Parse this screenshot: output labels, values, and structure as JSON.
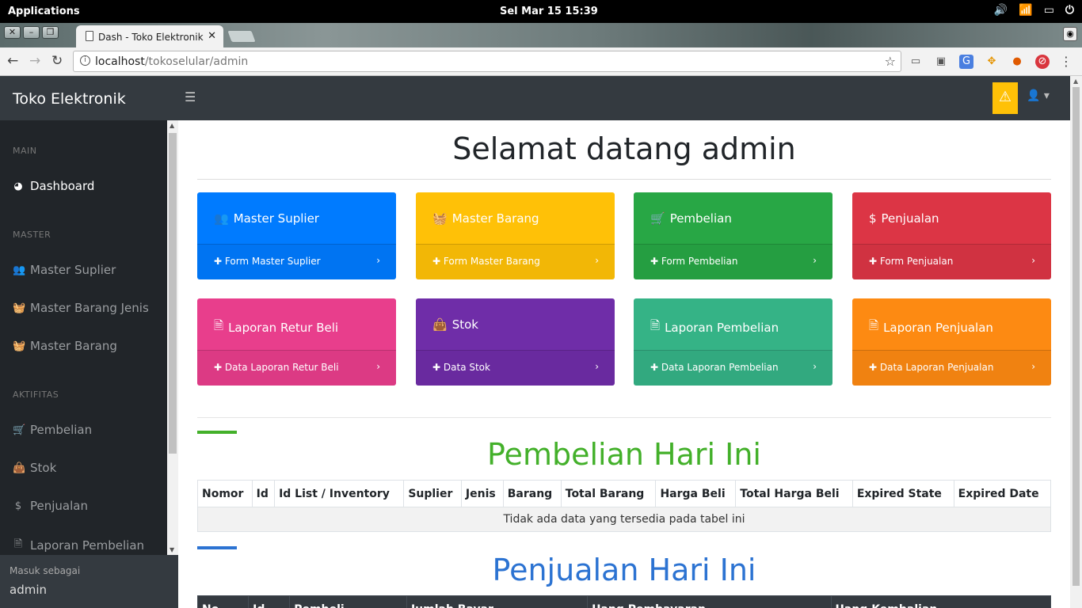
{
  "system": {
    "apps_label": "Applications",
    "clock": "Sel Mar 15    15:39"
  },
  "browser": {
    "tab_title": "Dash - Toko Elektronik",
    "url_host": "localhost",
    "url_path": "/tokoselular/admin"
  },
  "header": {
    "brand": "Toko Elektronik"
  },
  "sidebar": {
    "sections": [
      {
        "heading": "MAIN",
        "items": [
          {
            "label": "Dashboard",
            "icon": "dashboard-icon",
            "glyph": "◕"
          }
        ]
      },
      {
        "heading": "MASTER",
        "items": [
          {
            "label": "Master Suplier",
            "icon": "users-icon",
            "glyph": "👥"
          },
          {
            "label": "Master Barang Jenis",
            "icon": "basket-icon",
            "glyph": "🧺"
          },
          {
            "label": "Master Barang",
            "icon": "basket-icon",
            "glyph": "🧺"
          }
        ]
      },
      {
        "heading": "AKTIFITAS",
        "items": [
          {
            "label": "Pembelian",
            "icon": "cart-icon",
            "glyph": "🛒"
          },
          {
            "label": "Stok",
            "icon": "shopping-bag-icon",
            "glyph": "👜"
          },
          {
            "label": "Penjualan",
            "icon": "dollar-icon",
            "glyph": "$"
          },
          {
            "label": "Laporan Pembelian",
            "icon": "file-icon",
            "glyph": "🗎"
          }
        ]
      }
    ],
    "footer_label": "Masuk sebagai",
    "footer_user": "admin"
  },
  "main": {
    "welcome": "Selamat datang admin",
    "cards": [
      {
        "title": "Master Suplier",
        "link": "Form Master Suplier",
        "color": "#007bff",
        "icon": "users-icon",
        "glyph": "👥"
      },
      {
        "title": "Master Barang",
        "link": "Form Master Barang",
        "color": "#ffc107",
        "icon": "basket-icon",
        "glyph": "🧺"
      },
      {
        "title": "Pembelian",
        "link": "Form Pembelian",
        "color": "#28a745",
        "icon": "cart-icon",
        "glyph": "🛒"
      },
      {
        "title": "Penjualan",
        "link": "Form Penjualan",
        "color": "#dc3545",
        "icon": "dollar-icon",
        "glyph": "$"
      },
      {
        "title": "Laporan Retur Beli",
        "link": "Data Laporan Retur Beli",
        "color": "#e83e8c",
        "icon": "file-icon",
        "glyph": "🗎"
      },
      {
        "title": "Stok",
        "link": "Data Stok",
        "color": "#6f2da8",
        "icon": "shopping-bag-icon",
        "glyph": "👜"
      },
      {
        "title": "Laporan Pembelian",
        "link": "Data Laporan Pembelian",
        "color": "#35b386",
        "icon": "file-icon",
        "glyph": "🗎"
      },
      {
        "title": "Laporan Penjualan",
        "link": "Data Laporan Penjualan",
        "color": "#fd8a12",
        "icon": "file-icon",
        "glyph": "🗎"
      }
    ],
    "pembelian": {
      "title": "Pembelian Hari Ini",
      "color": "#43b02a",
      "columns": [
        "Nomor",
        "Id",
        "Id List / Inventory",
        "Suplier",
        "Jenis",
        "Barang",
        "Total Barang",
        "Harga Beli",
        "Total Harga Beli",
        "Expired State",
        "Expired Date"
      ],
      "empty_text": "Tidak ada data yang tersedia pada tabel ini"
    },
    "penjualan": {
      "title": "Penjualan Hari Ini",
      "color": "#2c73d2",
      "columns": [
        "No",
        "Id",
        "Pembeli",
        "Jumlah Bayar",
        "Uang Pembayaran",
        "Uang Kembalian"
      ]
    }
  }
}
